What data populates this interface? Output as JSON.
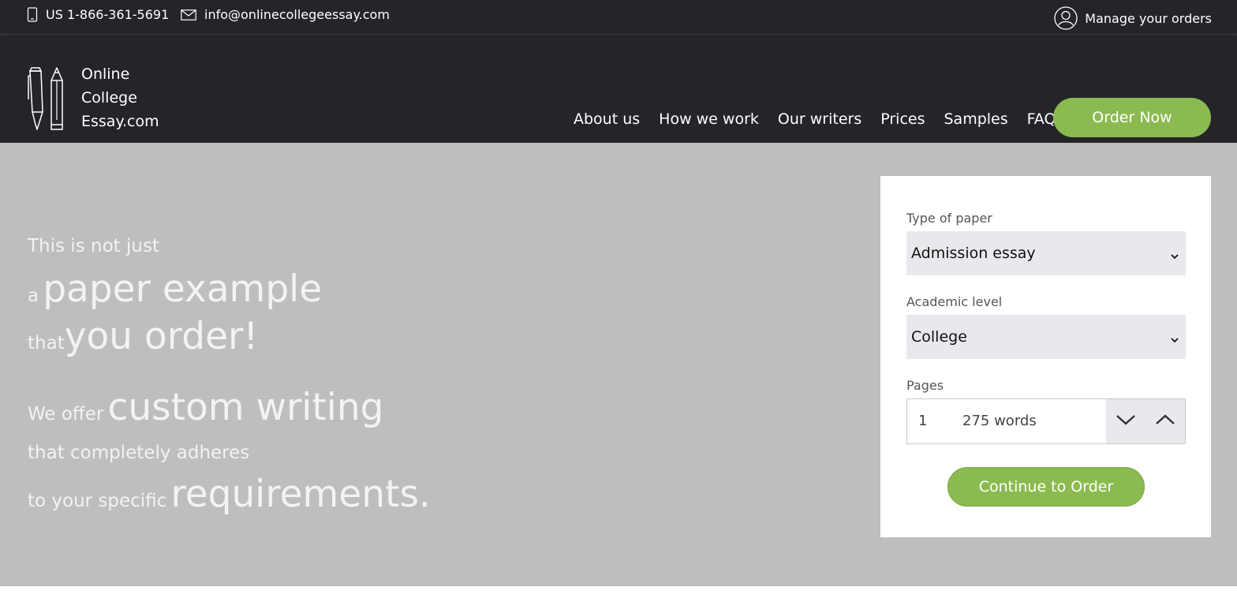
{
  "topbar": {
    "phone": "US 1-866-361-5691",
    "email": "info@onlinecollegeessay.com",
    "manage": "Manage your orders",
    "icons": {
      "phone": "phone-icon",
      "mail": "mail-icon",
      "user": "user-icon"
    }
  },
  "logo": {
    "line1": "Online",
    "line2": "College",
    "line3": "Essay.com",
    "icon": "pen-pencil-icon"
  },
  "nav": {
    "items": [
      "About us",
      "How we work",
      "Our writers",
      "Prices",
      "Samples",
      "FAQ"
    ],
    "order_now": "Order Now"
  },
  "hero": {
    "l1": "This is not just",
    "l2a": "a",
    "l2b": "paper example",
    "l3a": "that",
    "l3b": "you order!",
    "l4a": "We offer",
    "l4b": "custom writing",
    "l5": "that completely adheres",
    "l6a": "to your specific",
    "l6b": "requirements."
  },
  "order_form": {
    "paper_label": "Type of paper",
    "paper_value": "Admission essay",
    "level_label": "Academic level",
    "level_value": "College",
    "pages_label": "Pages",
    "pages_value": "1",
    "words": "275 words",
    "continue": "Continue to Order"
  },
  "colors": {
    "dark": "#252429",
    "accent": "#8bbb50",
    "hero_bg": "#bebebe",
    "select_bg": "#e9e8ec"
  }
}
